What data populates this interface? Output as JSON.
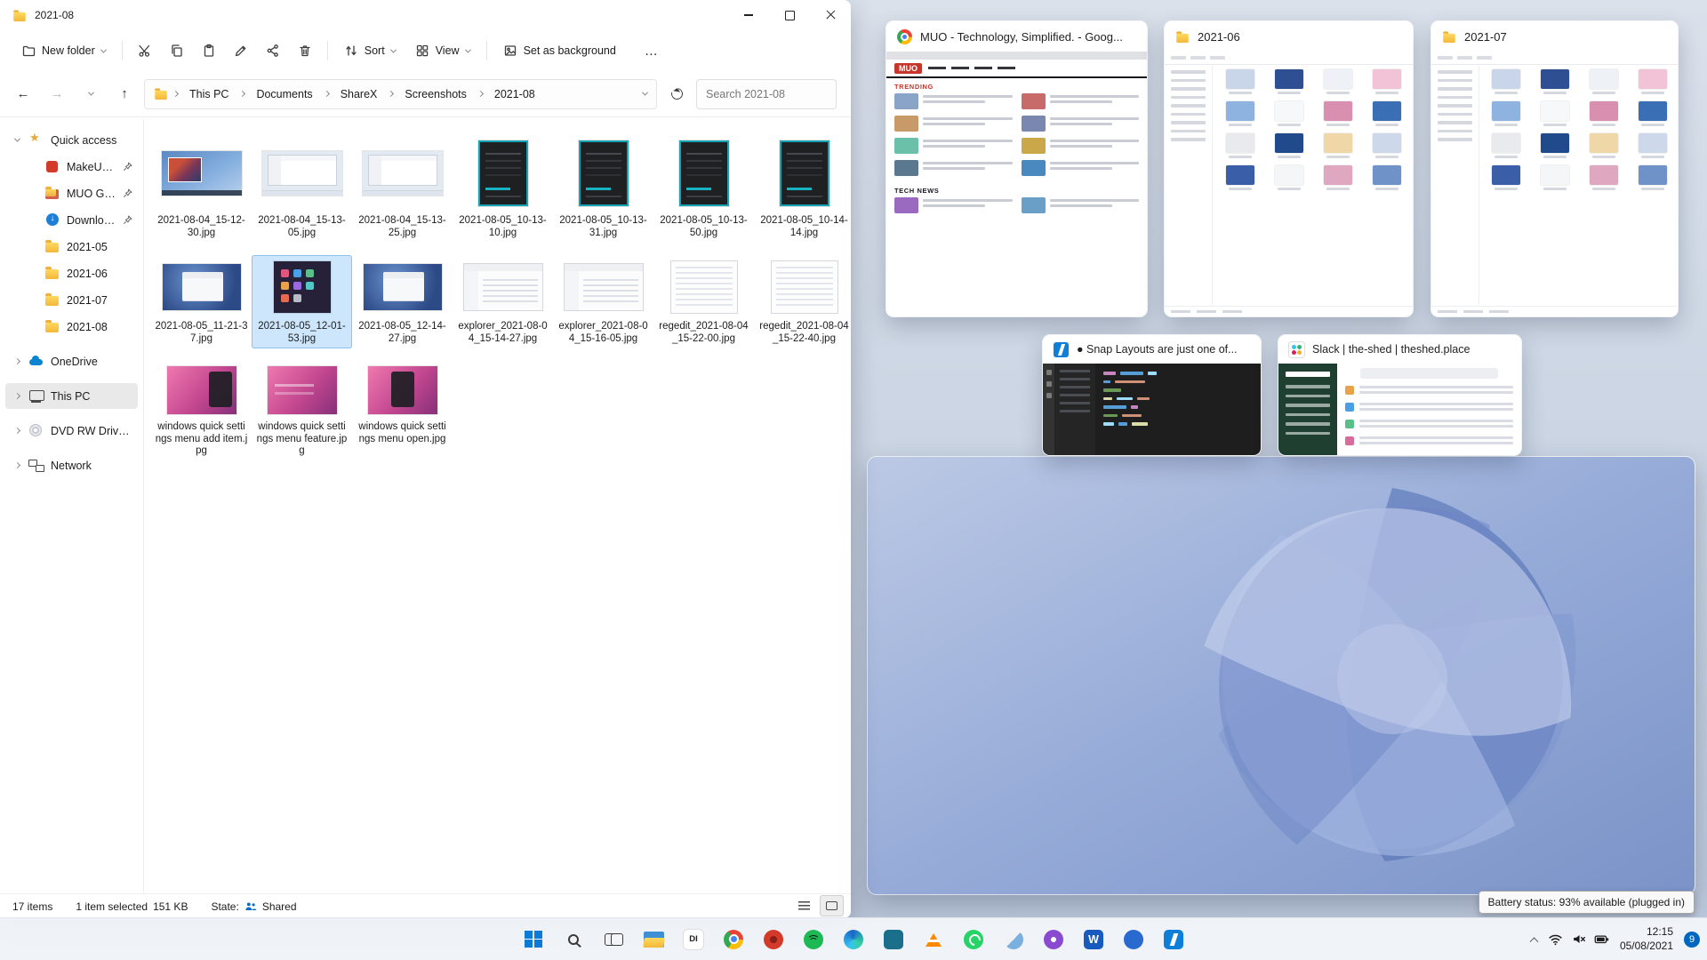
{
  "accent": "#0067c0",
  "explorer": {
    "title": "2021-08",
    "toolbar": {
      "new_folder": "New folder",
      "sort": "Sort",
      "view": "View",
      "set_as_background": "Set as background",
      "more": "…"
    },
    "address": {
      "crumbs": [
        "This PC",
        "Documents",
        "ShareX",
        "Screenshots",
        "2021-08"
      ],
      "search_placeholder": "Search 2021-08"
    },
    "sidebar": [
      {
        "label": "Quick access",
        "icon": "star",
        "chev": "down"
      },
      {
        "label": "MakeUseOf",
        "icon": "muo",
        "indent": 1,
        "pin": true
      },
      {
        "label": "MUO GD Screen",
        "icon": "folder-red",
        "indent": 1,
        "pin": true
      },
      {
        "label": "Downloads",
        "icon": "downloads",
        "indent": 1,
        "pin": true
      },
      {
        "label": "2021-05",
        "icon": "folder",
        "indent": 1
      },
      {
        "label": "2021-06",
        "icon": "folder",
        "indent": 1
      },
      {
        "label": "2021-07",
        "icon": "folder",
        "indent": 1
      },
      {
        "label": "2021-08",
        "icon": "folder",
        "indent": 1
      },
      {
        "label": "OneDrive",
        "icon": "cloud",
        "chev": "right",
        "gap": true
      },
      {
        "label": "This PC",
        "icon": "pc",
        "chev": "right",
        "gap": true,
        "selected": true
      },
      {
        "label": "DVD RW Drive (D:) A",
        "icon": "disc",
        "chev": "right",
        "gap": true
      },
      {
        "label": "Network",
        "icon": "net",
        "chev": "right",
        "gap": true
      }
    ],
    "files": [
      {
        "name": "2021-08-04_15-12-30.jpg",
        "thumb": "desktop1"
      },
      {
        "name": "2021-08-04_15-13-05.jpg",
        "thumb": "desktop2"
      },
      {
        "name": "2021-08-04_15-13-25.jpg",
        "thumb": "desktop2"
      },
      {
        "name": "2021-08-05_10-13-10.jpg",
        "thumb": "dark"
      },
      {
        "name": "2021-08-05_10-13-31.jpg",
        "thumb": "dark"
      },
      {
        "name": "2021-08-05_10-13-50.jpg",
        "thumb": "dark"
      },
      {
        "name": "2021-08-05_10-14-14.jpg",
        "thumb": "dark"
      },
      {
        "name": "2021-08-05_11-21-37.jpg",
        "thumb": "blue"
      },
      {
        "name": "2021-08-05_12-01-53.jpg",
        "thumb": "purple",
        "selected": true
      },
      {
        "name": "2021-08-05_12-14-27.jpg",
        "thumb": "blue"
      },
      {
        "name": "explorer_2021-08-04_15-14-27.jpg",
        "thumb": "white"
      },
      {
        "name": "explorer_2021-08-04_15-16-05.jpg",
        "thumb": "white"
      },
      {
        "name": "regedit_2021-08-04_15-22-00.jpg",
        "thumb": "whitelist"
      },
      {
        "name": "regedit_2021-08-04_15-22-40.jpg",
        "thumb": "whitelist"
      },
      {
        "name": "windows quick settings menu add item.jpg",
        "thumb": "pink-a"
      },
      {
        "name": "windows quick settings menu feature.jpg",
        "thumb": "pink-b"
      },
      {
        "name": "windows quick settings menu open.jpg",
        "thumb": "pink-c"
      }
    ],
    "status": {
      "count": "17 items",
      "selection": "1 item selected",
      "size": "151 KB",
      "state_label": "State:",
      "state_value": "Shared"
    }
  },
  "snap": {
    "cards": [
      {
        "title": "MUO - Technology, Simplified. - Goog...",
        "app": "chrome",
        "labels": {
          "logo": "MUO",
          "trending": "TRENDING",
          "technews": "TECH NEWS"
        }
      },
      {
        "title": "2021-06",
        "app": "file-explorer"
      },
      {
        "title": "2021-07",
        "app": "file-explorer"
      },
      {
        "title": "● Snap Layouts are just one of...",
        "app": "vscode"
      },
      {
        "title": "Slack | the-shed | theshed.place",
        "app": "slack"
      }
    ]
  },
  "taskbar": {
    "apps": [
      {
        "name": "start"
      },
      {
        "name": "search"
      },
      {
        "name": "task-view"
      },
      {
        "name": "file-explorer"
      },
      {
        "name": "app-di",
        "letter": "DI"
      },
      {
        "name": "chrome"
      },
      {
        "name": "muo"
      },
      {
        "name": "spotify"
      },
      {
        "name": "edge"
      },
      {
        "name": "app-teal"
      },
      {
        "name": "vlc"
      },
      {
        "name": "whatsapp"
      },
      {
        "name": "app-pink"
      },
      {
        "name": "podcasts"
      },
      {
        "name": "word",
        "letter": "W"
      },
      {
        "name": "app-blue"
      },
      {
        "name": "vscode"
      }
    ],
    "tray": {
      "time": "12:15",
      "date": "05/08/2021",
      "badge": "9"
    },
    "tooltip": "Battery status: 93% available (plugged in)"
  }
}
